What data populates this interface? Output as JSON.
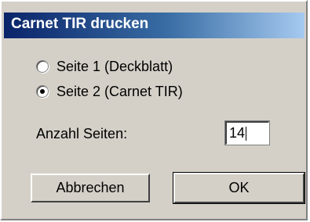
{
  "dialog": {
    "title": "Carnet TIR drucken",
    "options": [
      {
        "label": "Seite 1 (Deckblatt)",
        "checked": false
      },
      {
        "label": "Seite 2 (Carnet TIR)",
        "checked": true
      }
    ],
    "pages_label": "Anzahl Seiten:",
    "pages_value": "14",
    "cancel_label": "Abbrechen",
    "ok_label": "OK"
  },
  "colors": {
    "dialog_face": "#d4d0c8",
    "titlebar_start": "#0a246a",
    "titlebar_end": "#a6caf0"
  }
}
